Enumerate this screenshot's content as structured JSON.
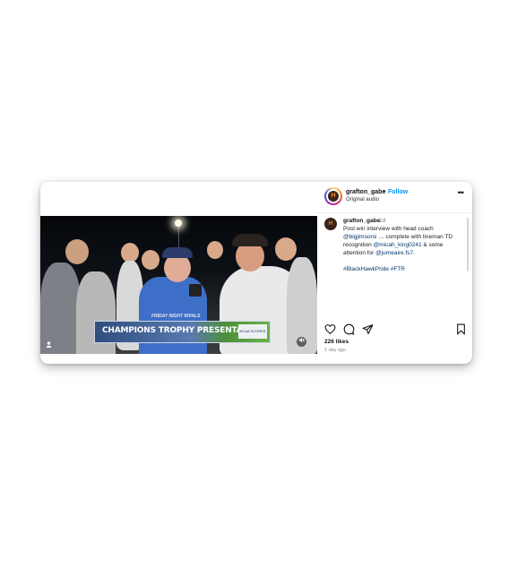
{
  "post": {
    "username": "grafton_gabe",
    "separator": "•",
    "follow_label": "Follow",
    "audio": "Original audio",
    "more_label": "•••",
    "avatar_glyph": "H"
  },
  "media": {
    "banner_text": "CHAMPIONS TROPHY PRESENTATION",
    "banner_top": "FRIDAY NIGHT RIVALS",
    "banner_logo": "NCAA SCORES",
    "icons": [
      "user-tag-icon",
      "mute-icon"
    ]
  },
  "caption": {
    "username": "grafton_gabe",
    "time": "1d",
    "text_1": "Post win interview with head coach",
    "mention_1": "@bigjimsorsi",
    "text_2": "… complete with lineman",
    "text_3": "TD recognition",
    "mention_2": "@micah_king0241",
    "text_4": "&",
    "text_5": "some attention for",
    "mention_3": "@jumeaire.fs7",
    "text_6": ".",
    "hashtag": "#BlackHawkPride #FTR"
  },
  "actions": {
    "icons": [
      "heart-icon",
      "comment-icon",
      "share-icon",
      "bookmark-icon"
    ],
    "likes": "226 likes",
    "time_ago": "1 day ago"
  },
  "colors": {
    "follow": "#0095f6",
    "mention": "#00376b"
  }
}
